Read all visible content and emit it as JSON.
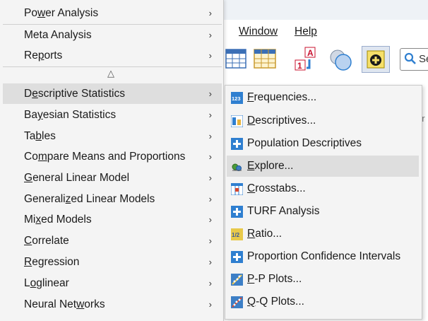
{
  "app_menubar": {
    "window": "Window",
    "help": "Help"
  },
  "search": {
    "value": "Se"
  },
  "background": {
    "column_header_fragment": "ar"
  },
  "main_menu": {
    "items": [
      {
        "pre": "Po",
        "key": "w",
        "post": "er Analysis",
        "has_submenu": true
      },
      {
        "pre": "",
        "key": "",
        "post": "Meta Analysis",
        "has_submenu": true
      },
      {
        "pre": "Re",
        "key": "p",
        "post": "orts",
        "has_submenu": true
      },
      {
        "pre": "D",
        "key": "e",
        "post": "scriptive Statistics",
        "has_submenu": true,
        "active": true
      },
      {
        "pre": "Ba",
        "key": "y",
        "post": "esian Statistics",
        "has_submenu": true
      },
      {
        "pre": "Ta",
        "key": "b",
        "post": "les",
        "has_submenu": true
      },
      {
        "pre": "Co",
        "key": "m",
        "post": "pare Means and Proportions",
        "has_submenu": true
      },
      {
        "pre": "",
        "key": "G",
        "post": "eneral Linear Model",
        "has_submenu": true
      },
      {
        "pre": "Generali",
        "key": "z",
        "post": "ed Linear Models",
        "has_submenu": true
      },
      {
        "pre": "Mi",
        "key": "x",
        "post": "ed Models",
        "has_submenu": true
      },
      {
        "pre": "",
        "key": "C",
        "post": "orrelate",
        "has_submenu": true
      },
      {
        "pre": "",
        "key": "R",
        "post": "egression",
        "has_submenu": true
      },
      {
        "pre": "L",
        "key": "o",
        "post": "glinear",
        "has_submenu": true
      },
      {
        "pre": "Neural Net",
        "key": "w",
        "post": "orks",
        "has_submenu": true
      }
    ],
    "scroll_up_glyph": "△",
    "submenu_arrow": "›"
  },
  "sub_menu": {
    "items": [
      {
        "pre": "",
        "key": "F",
        "post": "requencies...",
        "icon": "frequencies-icon"
      },
      {
        "pre": "",
        "key": "D",
        "post": "escriptives...",
        "icon": "descriptives-icon"
      },
      {
        "pre": "",
        "key": "",
        "post": "Population Descriptives",
        "icon": "plus-icon"
      },
      {
        "pre": "",
        "key": "E",
        "post": "xplore...",
        "icon": "explore-icon",
        "active": true
      },
      {
        "pre": "",
        "key": "C",
        "post": "rosstabs...",
        "icon": "crosstabs-icon"
      },
      {
        "pre": "",
        "key": "",
        "post": "TURF Analysis",
        "icon": "plus-icon"
      },
      {
        "pre": "",
        "key": "R",
        "post": "atio...",
        "icon": "ratio-icon"
      },
      {
        "pre": "",
        "key": "",
        "post": "Proportion Confidence Intervals",
        "icon": "plus-icon"
      },
      {
        "pre": "",
        "key": "P",
        "post": "-P Plots...",
        "icon": "pp-plot-icon"
      },
      {
        "pre": "",
        "key": "Q",
        "post": "-Q Plots...",
        "icon": "qq-plot-icon"
      }
    ]
  },
  "icons": {
    "frequencies_label": "123",
    "ratio_label": "1/2",
    "goto_case_letter": "A",
    "goto_case_number": "1"
  },
  "colors": {
    "menu_bg": "#f4f4f4",
    "highlight": "#dedede",
    "icon_blue": "#2f7fd0",
    "toolbar_yellow": "#f2d37a",
    "toolbar_blue": "#3b6fb6"
  }
}
